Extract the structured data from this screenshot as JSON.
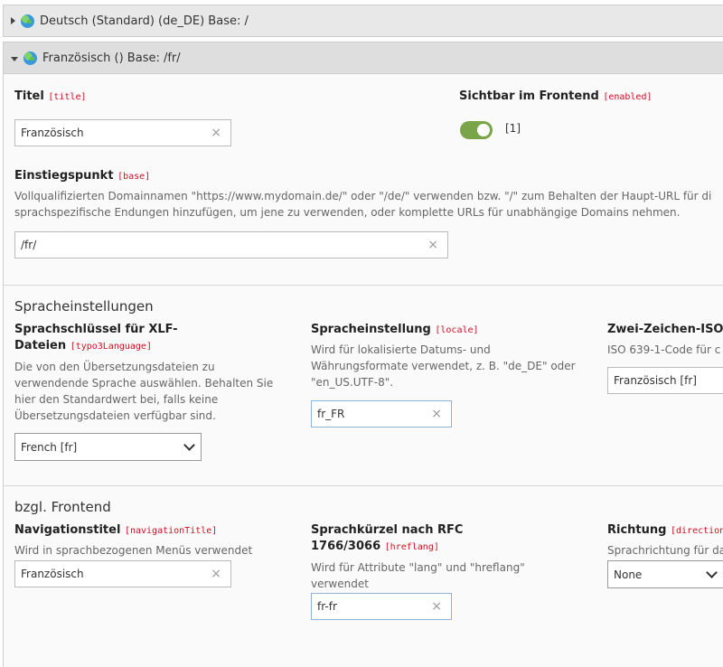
{
  "panels": {
    "de": {
      "title": "Deutsch (Standard) (de_DE) Base: /"
    },
    "fr": {
      "title": "Französisch () Base: /fr/"
    }
  },
  "general": {
    "title_label": "Titel",
    "title_tag": "[title]",
    "title_value": "Französisch",
    "enabled_label": "Sichtbar im Frontend",
    "enabled_tag": "[enabled]",
    "enabled_value": "[1]",
    "base_label": "Einstiegspunkt",
    "base_tag": "[base]",
    "base_desc_1": "Vollqualifizierten Domainnamen \"https://www.mydomain.de/\" oder \"/de/\" verwenden bzw. \"/\" zum Behalten der Haupt-URL für di",
    "base_desc_2": "sprachspezifische Endungen hinzufügen, um jene zu verwenden, oder komplette URLs für unabhängige Domains nehmen.",
    "base_value": "/fr/"
  },
  "language": {
    "heading": "Spracheinstellungen",
    "xlf_label_1": "Sprachschlüssel für XLF-",
    "xlf_label_2": "Dateien",
    "xlf_tag": "[typo3Language]",
    "xlf_desc": [
      "Die von den Übersetzungsdateien zu",
      "verwendende Sprache auswählen. Behalten Sie",
      "hier den Standardwert bei, falls keine",
      "Übersetzungsdateien verfügbar sind."
    ],
    "xlf_value": "French [fr]",
    "locale_label": "Spracheinstellung",
    "locale_tag": "[locale]",
    "locale_desc": [
      "Wird für lokalisierte Datums- und",
      "Währungsformate verwendet, z. B. \"de_DE\" oder",
      "\"en_US.UTF-8\"."
    ],
    "locale_value": "fr_FR",
    "iso_label": "Zwei-Zeichen-ISO-(",
    "iso_desc": "ISO 639-1-Code für c",
    "iso_value": "Französisch [fr]"
  },
  "frontend": {
    "heading": "bzgl. Frontend",
    "nav_label": "Navigationstitel",
    "nav_tag": "[navigationTitle]",
    "nav_desc": "Wird in sprachbezogenen Menüs verwendet",
    "nav_value": "Französisch",
    "hreflang_label_1": "Sprachkürzel nach RFC",
    "hreflang_label_2": "1766/3066",
    "hreflang_tag": "[hreflang]",
    "hreflang_desc": [
      "Wird für Attribute \"lang\" und \"hreflang\"",
      "verwendet"
    ],
    "hreflang_value": "fr-fr",
    "direction_label": "Richtung",
    "direction_tag": "[direction]",
    "direction_desc": "Sprachrichtung für da",
    "direction_value": "None"
  },
  "icons": {
    "clear": "×"
  }
}
